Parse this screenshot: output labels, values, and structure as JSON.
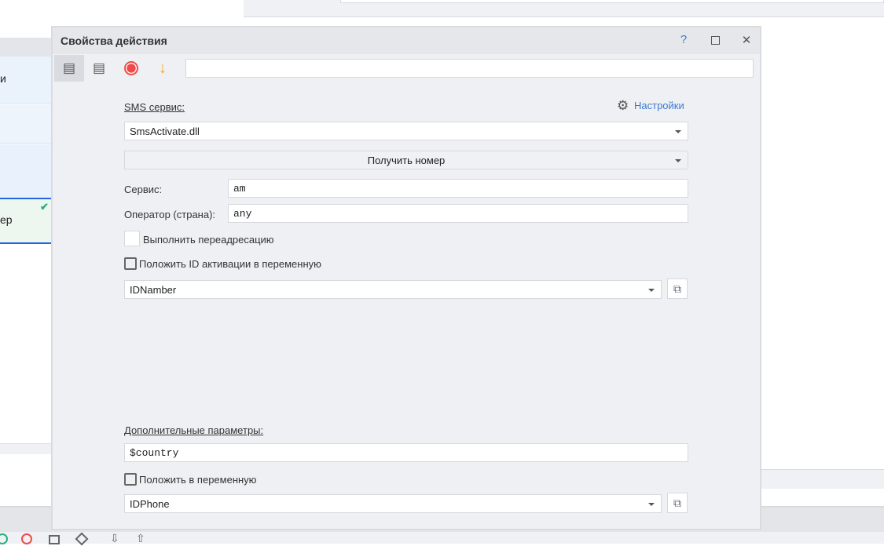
{
  "background": {
    "left_items": [
      {
        "label": "и"
      },
      {
        "label": "ер"
      }
    ]
  },
  "dialog": {
    "title": "Свойства действия",
    "help": "?",
    "toolbar_input": "",
    "sms_service_label": "SMS сервис:",
    "settings_link": "Настройки",
    "sms_service_value": "SmsActivate.dll",
    "action_value": "Получить номер",
    "service_label": "Сервис:",
    "service_value": "am",
    "operator_label": "Оператор (страна):",
    "operator_value": "any",
    "redirect_label": "Выполнить переадресацию",
    "save_id_label": "Положить ID активации в переменную",
    "id_var_value": "IDNamber",
    "extra_params_label": "Дополнительные параметры:",
    "extra_params_value": "$country",
    "save_var_label": "Положить в переменную",
    "phone_var_value": "IDPhone"
  },
  "colors": {
    "accent": "#3a7bd5",
    "record": "#f04a4a",
    "arrow": "#f5a623",
    "check": "#27b07a"
  }
}
